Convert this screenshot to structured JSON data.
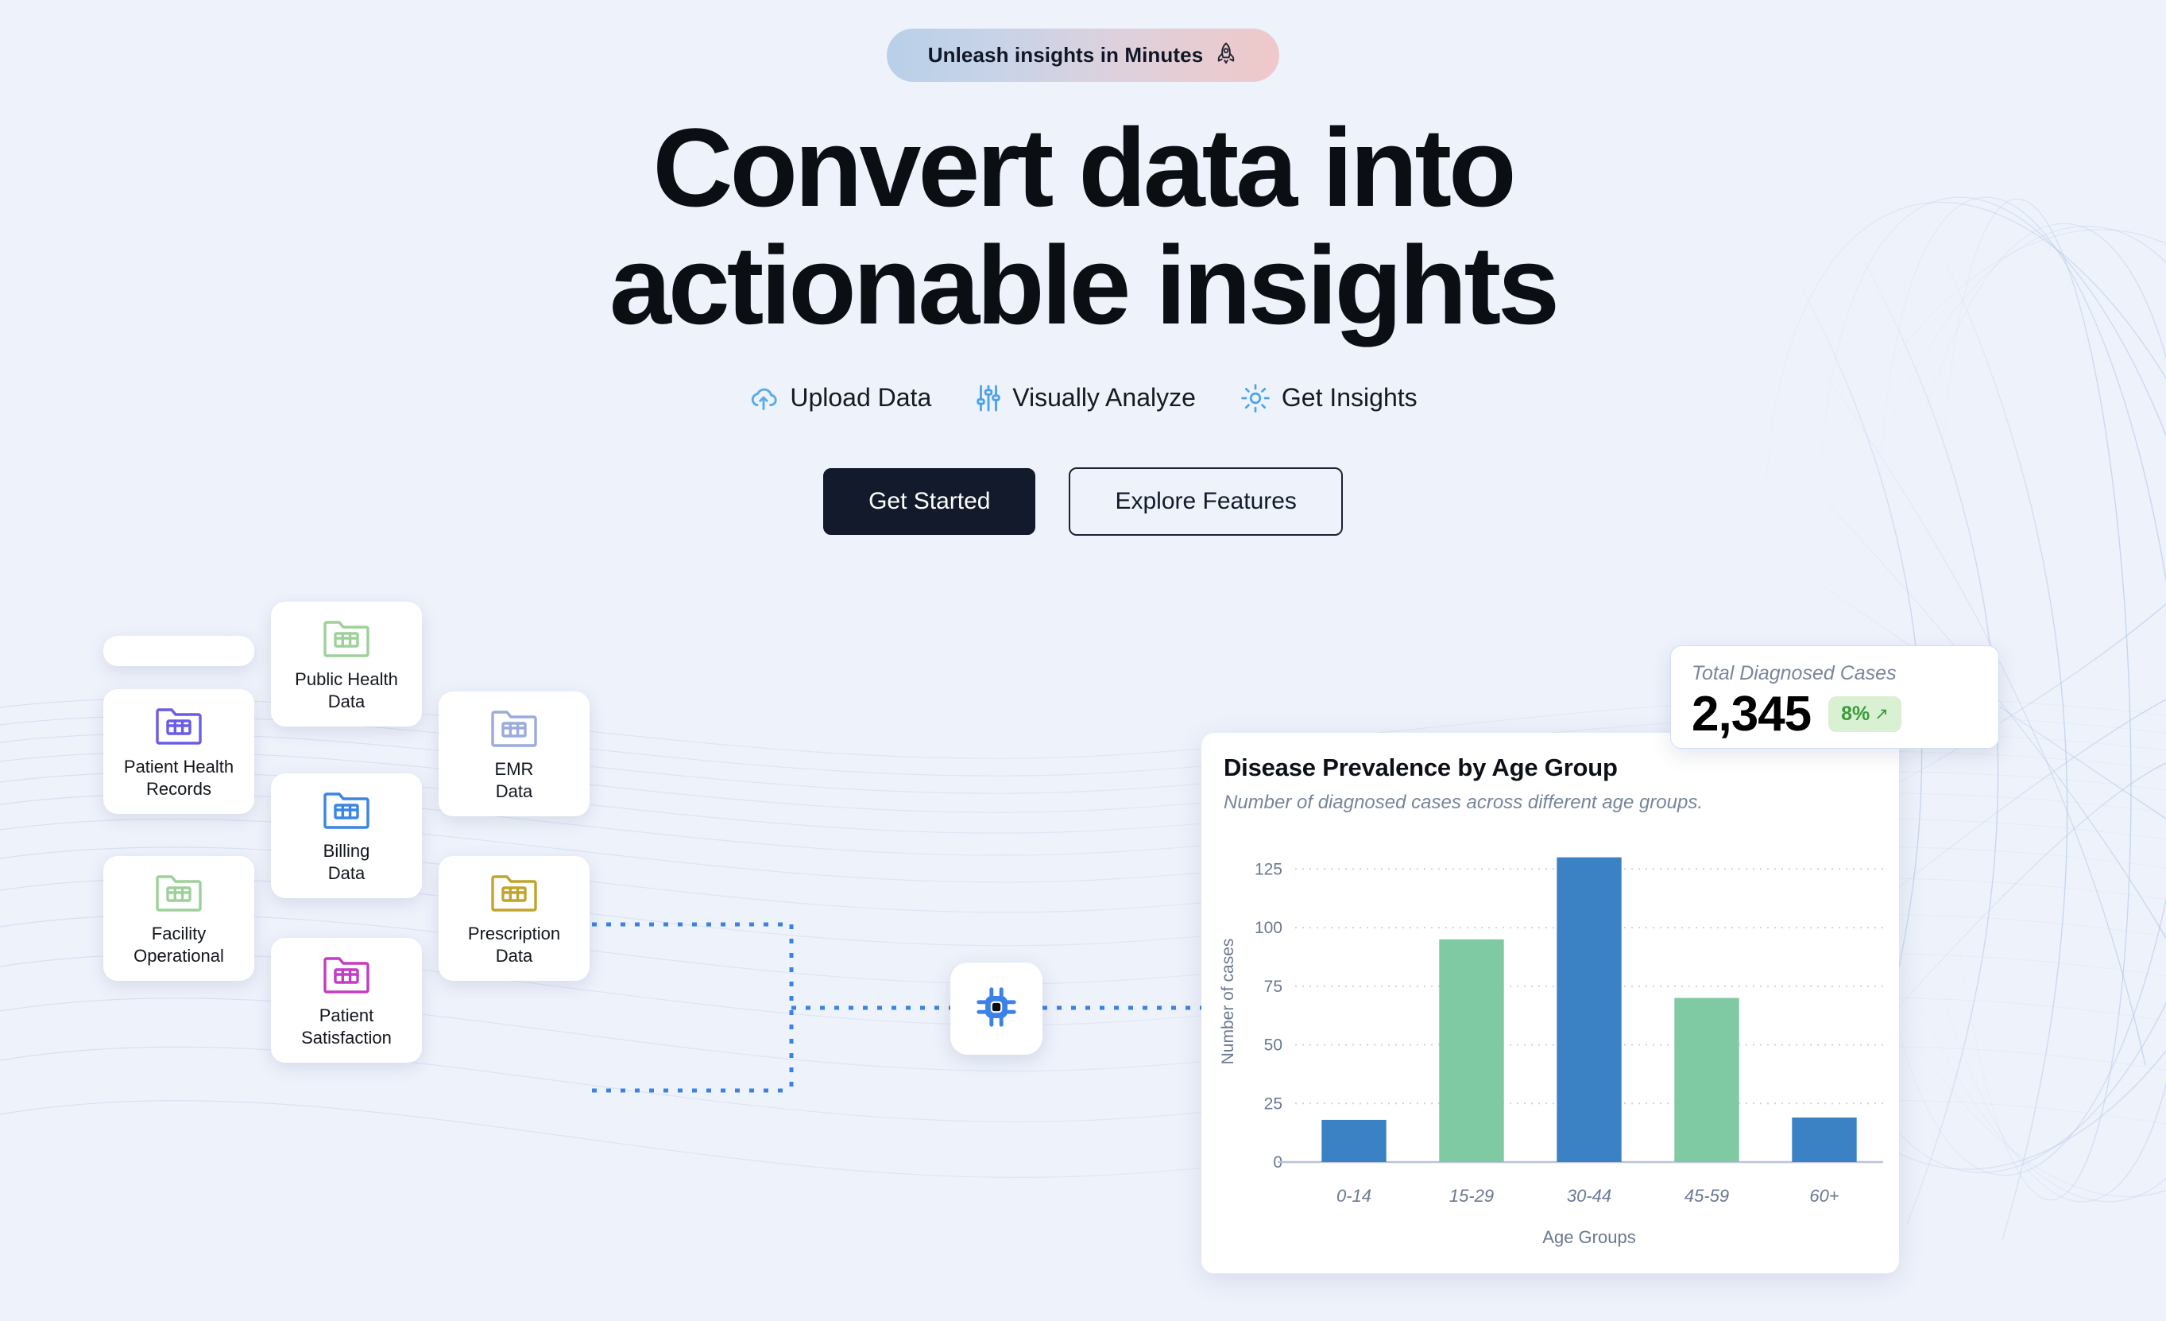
{
  "hero": {
    "badge_text": "Unleash insights in Minutes",
    "badge_icon": "rocket-icon",
    "badge_glyph": "🚀",
    "headline_line1": "Convert data into",
    "headline_line2": "actionable insights",
    "features": [
      {
        "label": "Upload Data",
        "icon": "cloud-upload-icon"
      },
      {
        "label": "Visually Analyze",
        "icon": "sliders-icon"
      },
      {
        "label": "Get Insights",
        "icon": "sun-insights-icon"
      }
    ],
    "primary_button": "Get Started",
    "secondary_button": "Explore Features"
  },
  "pipeline": {
    "processor_icon": "cpu-chip-icon",
    "sources": [
      {
        "label": "Patient Health\nRecords",
        "label_line1": "Patient Health",
        "label_line2": "Records",
        "color": "#6b5ce7",
        "icon": "folder-table-icon"
      },
      {
        "label": "Public Health\nData",
        "label_line1": "Public Health",
        "label_line2": "Data",
        "color": "#9ed19a",
        "icon": "folder-table-icon"
      },
      {
        "label": "EMR\nData",
        "label_line1": "EMR",
        "label_line2": "Data",
        "color": "#9aabdc",
        "icon": "folder-table-icon"
      },
      {
        "label": "Billing\nData",
        "label_line1": "Billing",
        "label_line2": "Data",
        "color": "#3b86e0",
        "icon": "folder-table-icon"
      },
      {
        "label": "Facility\nOperational",
        "label_line1": "Facility",
        "label_line2": "Operational",
        "color": "#9ed19a",
        "icon": "folder-table-icon"
      },
      {
        "label": "Prescription\nData",
        "label_line1": "Prescription",
        "label_line2": "Data",
        "color": "#c2a42b",
        "icon": "folder-table-icon"
      },
      {
        "label": "Patient\nSatisfaction",
        "label_line1": "Patient",
        "label_line2": "Satisfaction",
        "color": "#c33cc3",
        "icon": "folder-table-icon"
      }
    ],
    "connector_color": "#3b82e8"
  },
  "kpi": {
    "label": "Total Diagnosed Cases",
    "value": "2,345",
    "delta": "8%",
    "delta_arrow": "↗",
    "delta_color": "#3a9b3a",
    "delta_bg": "#d9f0d3"
  },
  "chart_data": {
    "type": "bar",
    "title": "Disease Prevalence by Age Group",
    "subtitle": "Number of diagnosed cases across different age groups.",
    "categories": [
      "0-14",
      "15-29",
      "30-44",
      "45-59",
      "60+"
    ],
    "values": [
      18,
      95,
      130,
      70,
      19
    ],
    "colors": [
      "#3b82c4",
      "#7fc9a3",
      "#3b82c4",
      "#7fc9a3",
      "#3b82c4"
    ],
    "xlabel": "Age Groups",
    "ylabel": "Number of cases",
    "yticks": [
      0,
      25,
      50,
      75,
      100,
      125
    ],
    "ylim": [
      0,
      137
    ],
    "grid": true,
    "legend": false
  }
}
